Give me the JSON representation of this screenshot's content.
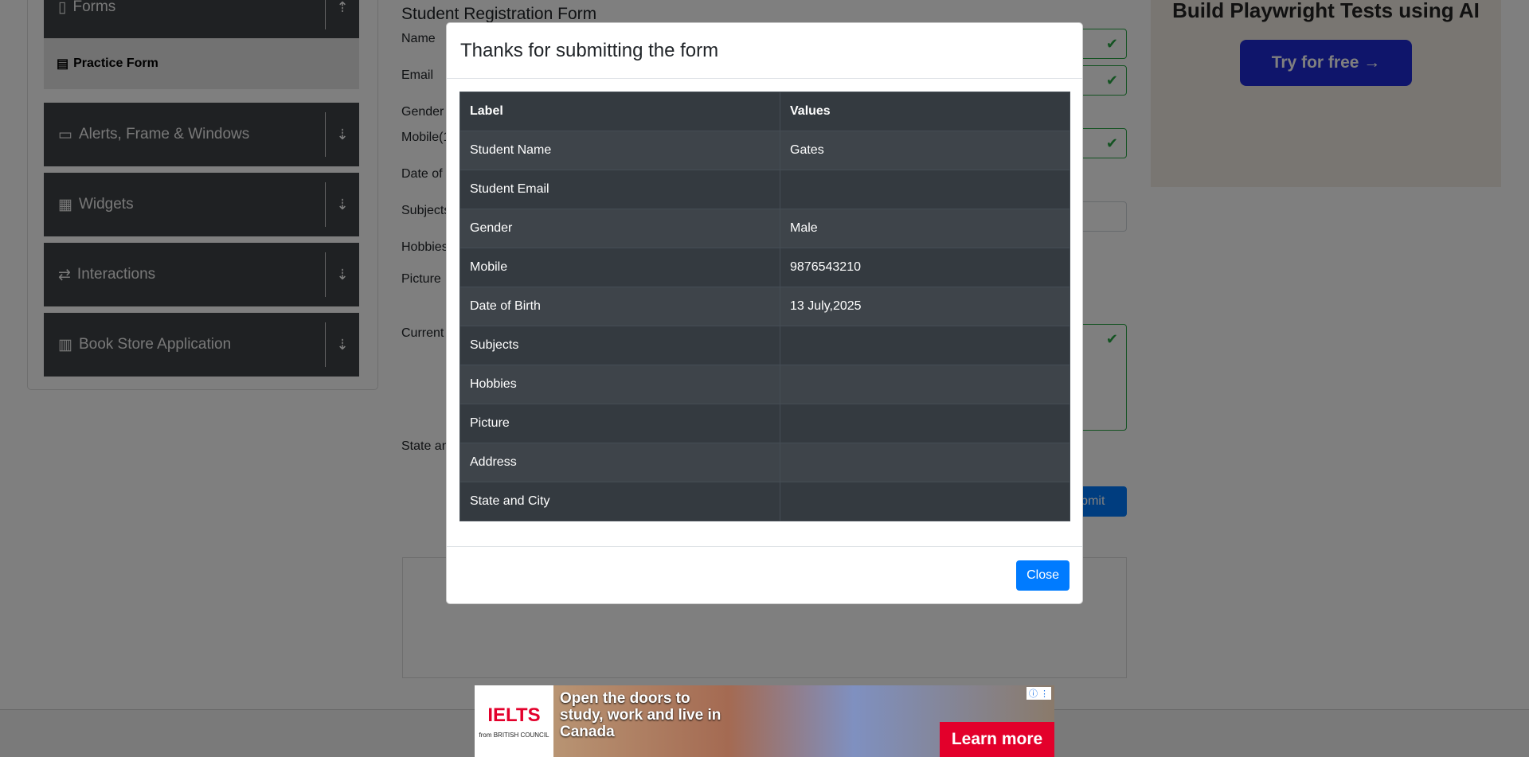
{
  "sidebar": {
    "groups": [
      {
        "label": "Forms",
        "icon": "clipboard-icon"
      },
      {
        "label": "Alerts, Frame & Windows",
        "icon": "window-icon"
      },
      {
        "label": "Widgets",
        "icon": "grid-icon"
      },
      {
        "label": "Interactions",
        "icon": "arrows-icon"
      },
      {
        "label": "Book Store Application",
        "icon": "books-icon"
      }
    ],
    "active_item": "Practice Form"
  },
  "form": {
    "title": "Student Registration Form",
    "labels": {
      "name": "Name",
      "email": "Email",
      "gender": "Gender",
      "mobile": "Mobile(1",
      "dob": "Date of",
      "subjects": "Subjects",
      "hobbies": "Hobbies",
      "picture": "Picture",
      "address": "Current",
      "state": "State an"
    },
    "submit_label": "Submit"
  },
  "ad_right": {
    "title": "Build Playwright Tests using AI",
    "button": "Try for free →"
  },
  "modal": {
    "title": "Thanks for submitting the form",
    "headers": [
      "Label",
      "Values"
    ],
    "rows": [
      {
        "label": "Student Name",
        "value": "Gates"
      },
      {
        "label": "Student Email",
        "value": ""
      },
      {
        "label": "Gender",
        "value": "Male"
      },
      {
        "label": "Mobile",
        "value": "9876543210"
      },
      {
        "label": "Date of Birth",
        "value": "13 July,2025"
      },
      {
        "label": "Subjects",
        "value": ""
      },
      {
        "label": "Hobbies",
        "value": ""
      },
      {
        "label": "Picture",
        "value": ""
      },
      {
        "label": "Address",
        "value": ""
      },
      {
        "label": "State and City",
        "value": ""
      }
    ],
    "close_label": "Close"
  },
  "ad_bottom": {
    "brand": "IELTS",
    "partner": "from BRITISH COUNCIL",
    "headline": "Open the doors to study, work and live in Canada",
    "cta": "Learn more"
  }
}
